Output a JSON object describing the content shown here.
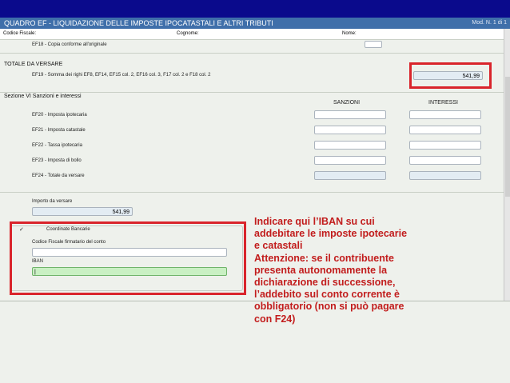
{
  "window": {
    "title": "QUADRO EF - LIQUIDAZIONE DELLE IMPOSTE IPOCATASTALI E ALTRI TRIBUTI",
    "right_text": "Mod. N. 1 di 1"
  },
  "header": {
    "codice_fiscale_label": "Codice Fiscale:",
    "cognome_label": "Cognome:",
    "nome_label": "Nome:"
  },
  "rows": {
    "ef18_label": "EF18 - Copia conforme all'originale",
    "totale_section": "TOTALE DA VERSARE",
    "ef19_label": "EF19 - Somma dei righi EF8, EF14, EF15 col. 2, EF16 col. 3, F17 col. 2 e F18 col. 2",
    "ef19_value": "541,99"
  },
  "sanzioni": {
    "section_title": "Sezione VI Sanzioni e interessi",
    "col_sanzioni": "SANZIONI",
    "col_interessi": "INTERESSI",
    "items": [
      {
        "label": "EF20 - Imposta ipotecaria"
      },
      {
        "label": "EF21 - Imposta catastale"
      },
      {
        "label": "EF22 - Tassa ipotecaria"
      },
      {
        "label": "EF23 - Imposta di bollo"
      },
      {
        "label": "EF24 - Totale da versare"
      }
    ]
  },
  "importo": {
    "label": "Importo da versare",
    "value": "541,99"
  },
  "coordinate": {
    "check": "✓",
    "title": "Coordinate Bancarie",
    "cf_label": "Codice Fiscale firmatario del conto",
    "iban_label": "IBAN",
    "iban_value": "|"
  },
  "note": {
    "line1": "Indicare qui l’IBAN su cui",
    "line2": "addebitare le imposte ipotecarie",
    "line3": "e catastali",
    "line4": "Attenzione: se il contribuente",
    "line5": "presenta autonomamente la",
    "line6": "dichiarazione di successione,",
    "line7": "l’addebito sul conto corrente è",
    "line8": "obbligatorio (non si può pagare",
    "line9": "con F24)"
  },
  "colors": {
    "highlight_red": "#d9242b",
    "note_text": "#c21d1d",
    "titlebar": "#3f6faa",
    "iban_field": "#c9f0c3"
  }
}
